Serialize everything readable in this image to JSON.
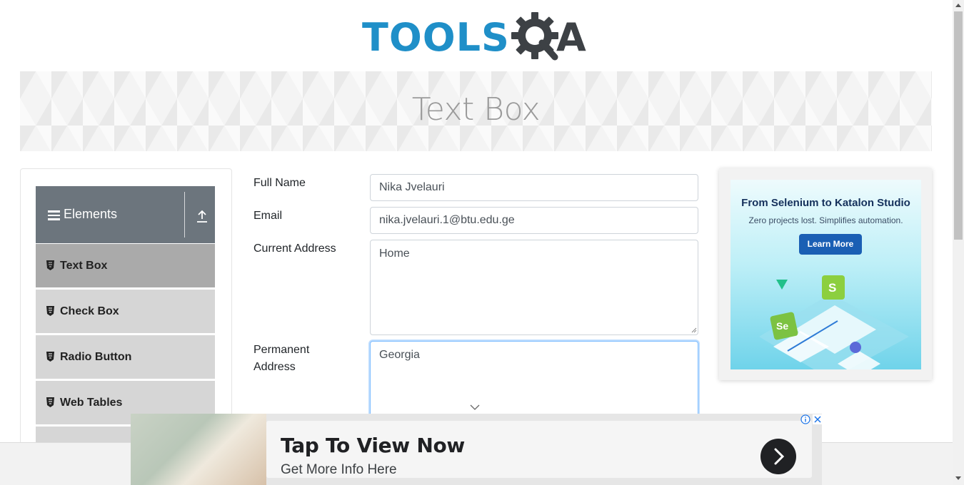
{
  "logo": {
    "text": "TOOLS",
    "trailing_letter": "A",
    "brand_color": "#1f8fc8",
    "dark_color": "#3d4145"
  },
  "banner": {
    "title": "Text Box"
  },
  "sidebar": {
    "header": {
      "label": "Elements",
      "icon": "hamburger-icon",
      "collapse_icon": "upload-icon"
    },
    "items": [
      {
        "label": "Text Box",
        "icon": "html5-icon",
        "active": true
      },
      {
        "label": "Check Box",
        "icon": "html5-icon",
        "active": false
      },
      {
        "label": "Radio Button",
        "icon": "html5-icon",
        "active": false
      },
      {
        "label": "Web Tables",
        "icon": "html5-icon",
        "active": false
      }
    ]
  },
  "form": {
    "full_name": {
      "label": "Full Name",
      "value": "Nika Jvelauri"
    },
    "email": {
      "label": "Email",
      "value": "nika.jvelauri.1@btu.edu.ge"
    },
    "current_address": {
      "label": "Current Address",
      "value": "Home"
    },
    "permanent_address": {
      "label_line1": "Permanent",
      "label_line2": "Address",
      "value": "Georgia"
    }
  },
  "right_ad": {
    "headline": "From Selenium to Katalon Studio",
    "subline": "Zero projects lost. Simplifies automation.",
    "button_label": "Learn More"
  },
  "bottom_ad": {
    "title": "Tap To View Now",
    "subtitle": "Get More Info Here",
    "arrow_icon": "chevron-right-icon",
    "info_icon": "ad-info-icon",
    "close_icon": "close-icon"
  }
}
